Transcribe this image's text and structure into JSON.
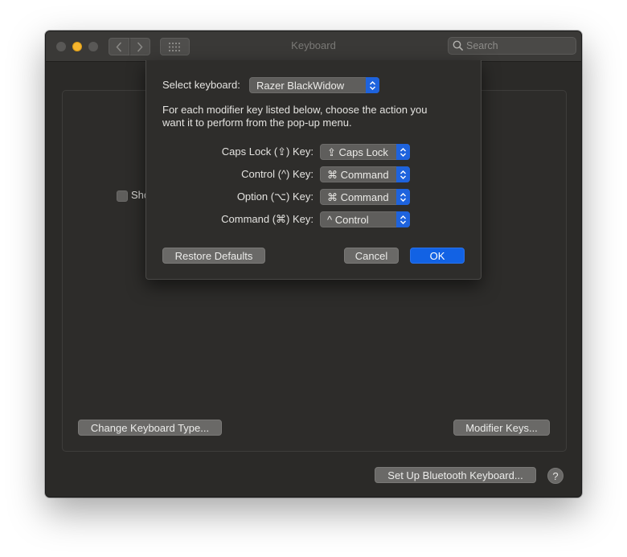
{
  "window": {
    "title": "Keyboard",
    "search_placeholder": "Search"
  },
  "panel": {
    "checkbox_label_partial": "Sho",
    "change_keyboard_type_button": "Change Keyboard Type...",
    "modifier_keys_button": "Modifier Keys...",
    "bluetooth_button": "Set Up Bluetooth Keyboard...",
    "help_button": "?"
  },
  "sheet": {
    "select_keyboard_label": "Select keyboard:",
    "selected_keyboard": "Razer BlackWidow",
    "description_line1": "For each modifier key listed below, choose the action you",
    "description_line2": "want it to perform from the pop-up menu.",
    "modifiers": [
      {
        "label": "Caps Lock (⇪) Key:",
        "value": "⇪ Caps Lock"
      },
      {
        "label": "Control (^) Key:",
        "value": "⌘ Command"
      },
      {
        "label": "Option (⌥) Key:",
        "value": "⌘ Command"
      },
      {
        "label": "Command (⌘) Key:",
        "value": "^ Control"
      }
    ],
    "restore_defaults_button": "Restore Defaults",
    "cancel_button": "Cancel",
    "ok_button": "OK"
  },
  "colors": {
    "accent": "#1262e4",
    "minimize": "#f5b52e",
    "window_background": "#2b2a28"
  },
  "icons": {
    "back": "chevron-left-icon",
    "forward": "chevron-right-icon",
    "show_all": "grid-icon",
    "search": "magnifier-icon",
    "popup": "up-down-chevron-icon"
  }
}
